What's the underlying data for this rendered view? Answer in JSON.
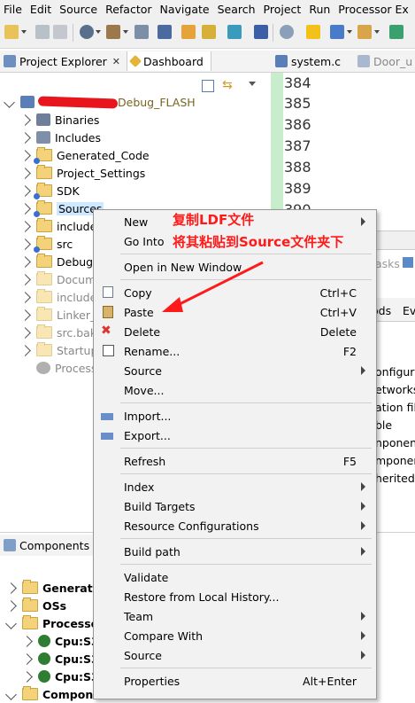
{
  "menubar": [
    "File",
    "Edit",
    "Source",
    "Refactor",
    "Navigate",
    "Search",
    "Project",
    "Run",
    "Processor Ex"
  ],
  "tabs": {
    "project_explorer": "Project Explorer",
    "dashboard": "Dashboard",
    "editor_tab1": "system.c",
    "editor_tab2": "Door_u",
    "components": "Components -"
  },
  "tree": {
    "project_suffix": "Debug_FLASH",
    "items": [
      "Binaries",
      "Includes",
      "Generated_Code",
      "Project_Settings",
      "SDK",
      "Sources",
      "include",
      "src",
      "Debug_",
      "Docum",
      "include",
      "Linker_",
      "src.bak",
      "Startup",
      "Process"
    ]
  },
  "editor": {
    "lines": [
      "384",
      "385",
      "386",
      "387",
      "388",
      "389",
      "390"
    ]
  },
  "right_panel": {
    "tab_fragments": [
      "asks",
      "ods",
      "Ev"
    ],
    "lines": [
      "onfigurat",
      "etworks",
      "ation file",
      "ble",
      "nponents",
      "mponen",
      "herited"
    ]
  },
  "components_tree": [
    "Generator",
    "OSs",
    "Processor",
    "Cpu:S3",
    "Cpu:S3",
    "Cpu:S3",
    "Components"
  ],
  "context_menu": {
    "items": [
      {
        "label": "New",
        "submenu": true
      },
      {
        "label": "Go Into"
      },
      {
        "label": "Open in New Window"
      },
      {
        "label": "Copy",
        "shortcut": "Ctrl+C",
        "icon": "copy-icon"
      },
      {
        "label": "Paste",
        "shortcut": "Ctrl+V",
        "icon": "paste-icon"
      },
      {
        "label": "Delete",
        "shortcut": "Delete",
        "icon": "delete-icon"
      },
      {
        "label": "Rename...",
        "shortcut": "F2",
        "icon": "rename-icon"
      },
      {
        "label": "Source",
        "submenu": true
      },
      {
        "label": "Move..."
      },
      {
        "label": "Import...",
        "icon": "import-icon"
      },
      {
        "label": "Export...",
        "icon": "export-icon"
      },
      {
        "label": "Refresh",
        "shortcut": "F5"
      },
      {
        "label": "Index",
        "submenu": true
      },
      {
        "label": "Build Targets",
        "submenu": true
      },
      {
        "label": "Resource Configurations",
        "submenu": true
      },
      {
        "label": "Build path",
        "submenu": true
      },
      {
        "label": "Validate"
      },
      {
        "label": "Restore from Local History..."
      },
      {
        "label": "Team",
        "submenu": true
      },
      {
        "label": "Compare With",
        "submenu": true
      },
      {
        "label": "Source",
        "submenu": true
      },
      {
        "label": "Properties",
        "shortcut": "Alt+Enter"
      }
    ]
  },
  "annotations": {
    "line1": "复制LDF文件",
    "line2": "将其粘贴到Source文件夹下"
  },
  "colors": {
    "annotation": "#ff1a1a",
    "editor_gutter": "#c7edcc",
    "folder": "#f3d27a"
  }
}
